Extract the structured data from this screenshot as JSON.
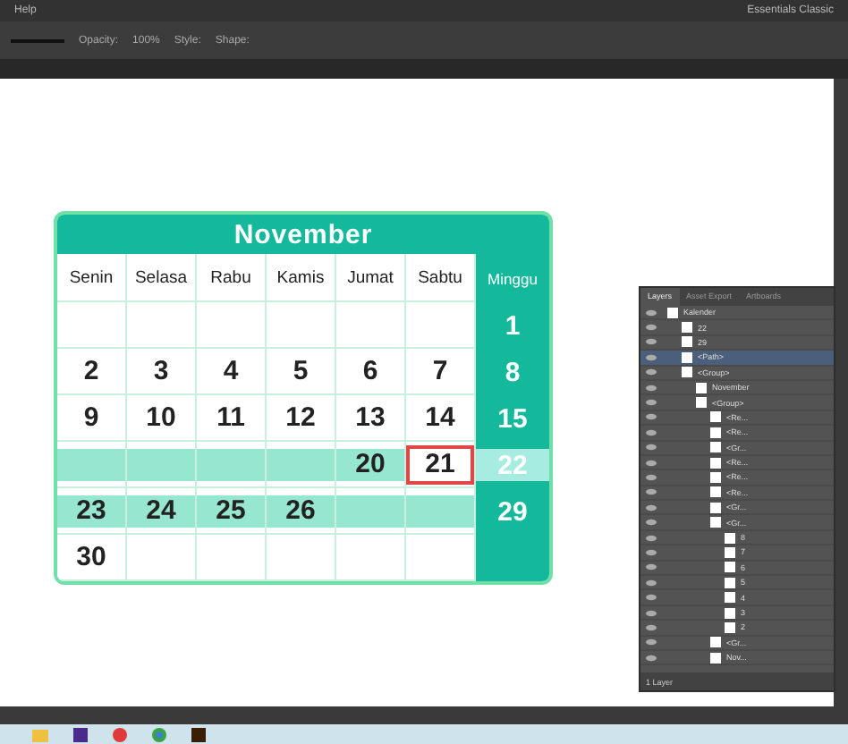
{
  "menu_bar": {
    "items": [
      "Help"
    ],
    "workspace": "Essentials Classic"
  },
  "control_bar": {
    "labels": [
      "Opacity:",
      "100%",
      "Style:",
      "Shape:"
    ]
  },
  "calendar": {
    "title": "November",
    "weekdays": [
      "Senin",
      "Selasa",
      "Rabu",
      "Kamis",
      "Jumat",
      "Sabtu",
      "Minggu"
    ],
    "weeks": [
      [
        {
          "highlighted": false,
          "selected": false
        },
        {
          "highlighted": false,
          "selected": false
        },
        {
          "highlighted": false,
          "selected": false
        },
        {
          "highlighted": false,
          "selected": false
        },
        {
          "highlighted": false,
          "selected": false
        },
        {
          "highlighted": false,
          "selected": false
        },
        {
          "text": "1",
          "highlighted": false,
          "selected": false
        }
      ],
      [
        {
          "text": "2",
          "highlighted": false,
          "selected": false
        },
        {
          "text": "3",
          "highlighted": false,
          "selected": false
        },
        {
          "text": "4",
          "highlighted": false,
          "selected": false
        },
        {
          "text": "5",
          "highlighted": false,
          "selected": false
        },
        {
          "text": "6",
          "highlighted": false,
          "selected": false
        },
        {
          "text": "7",
          "highlighted": false,
          "selected": false
        },
        {
          "text": "8",
          "highlighted": false,
          "selected": false
        }
      ],
      [
        {
          "text": "9",
          "highlighted": false,
          "selected": false
        },
        {
          "text": "10",
          "highlighted": false,
          "selected": false
        },
        {
          "text": "11",
          "highlighted": false,
          "selected": false
        },
        {
          "text": "12",
          "highlighted": false,
          "selected": false
        },
        {
          "text": "13",
          "highlighted": false,
          "selected": false
        },
        {
          "text": "14",
          "highlighted": false,
          "selected": false
        },
        {
          "text": "15",
          "highlighted": false,
          "selected": false
        }
      ],
      [
        {
          "highlighted": true,
          "selected": false
        },
        {
          "highlighted": true,
          "selected": false
        },
        {
          "highlighted": true,
          "selected": false
        },
        {
          "highlighted": true,
          "selected": false
        },
        {
          "text": "20",
          "highlighted": true,
          "selected": false
        },
        {
          "text": "21",
          "highlighted": false,
          "selected": true
        },
        {
          "text": "22",
          "highlighted": true,
          "selected": false
        }
      ],
      [
        {
          "text": "23",
          "highlighted": true,
          "selected": false
        },
        {
          "text": "24",
          "highlighted": true,
          "selected": false
        },
        {
          "text": "25",
          "highlighted": true,
          "selected": false
        },
        {
          "text": "26",
          "highlighted": true,
          "selected": false
        },
        {
          "highlighted": true,
          "selected": false
        },
        {
          "highlighted": true,
          "selected": false
        },
        {
          "text": "29",
          "highlighted": false,
          "selected": false
        }
      ],
      [
        {
          "text": "30",
          "highlighted": false,
          "selected": false
        },
        {
          "highlighted": false,
          "selected": false
        },
        {
          "highlighted": false,
          "selected": false
        },
        {
          "highlighted": false,
          "selected": false
        },
        {
          "highlighted": false,
          "selected": false
        },
        {
          "highlighted": false,
          "selected": false
        },
        {
          "highlighted": false,
          "selected": false
        }
      ]
    ]
  },
  "layers_panel": {
    "tabs": [
      {
        "label": "Layers",
        "selected": true
      },
      {
        "label": "Asset Export",
        "selected": false
      },
      {
        "label": "Artboards",
        "selected": false
      }
    ],
    "tree": [
      {
        "name": "Kalender",
        "selected": false,
        "children": [
          {
            "name": "22",
            "selected": false
          },
          {
            "name": "29",
            "selected": false
          },
          {
            "name": "<Path>",
            "selected": true
          },
          {
            "name": "<Group>",
            "selected": false,
            "children": [
              {
                "name": "November",
                "selected": false
              },
              {
                "name": "<Group>",
                "selected": false,
                "children": [
                  {
                    "name": "<Re...",
                    "selected": false
                  },
                  {
                    "name": "<Re...",
                    "selected": false
                  },
                  {
                    "name": "<Gr...",
                    "selected": false
                  },
                  {
                    "name": "<Re...",
                    "selected": false
                  },
                  {
                    "name": "<Re...",
                    "selected": false
                  },
                  {
                    "name": "<Re...",
                    "selected": false
                  },
                  {
                    "name": "<Gr...",
                    "selected": false
                  },
                  {
                    "name": "<Gr...",
                    "selected": false,
                    "children": [
                      {
                        "name": "8",
                        "selected": false
                      },
                      {
                        "name": "7",
                        "selected": false
                      },
                      {
                        "name": "6",
                        "selected": false
                      },
                      {
                        "name": "5",
                        "selected": false
                      },
                      {
                        "name": "4",
                        "selected": false
                      },
                      {
                        "name": "3",
                        "selected": false
                      },
                      {
                        "name": "2",
                        "selected": false
                      }
                    ]
                  },
                  {
                    "name": "<Gr...",
                    "selected": false
                  },
                  {
                    "name": "Nov...",
                    "selected": false
                  }
                ]
              }
            ]
          }
        ]
      }
    ],
    "footer": "1 Layer"
  }
}
